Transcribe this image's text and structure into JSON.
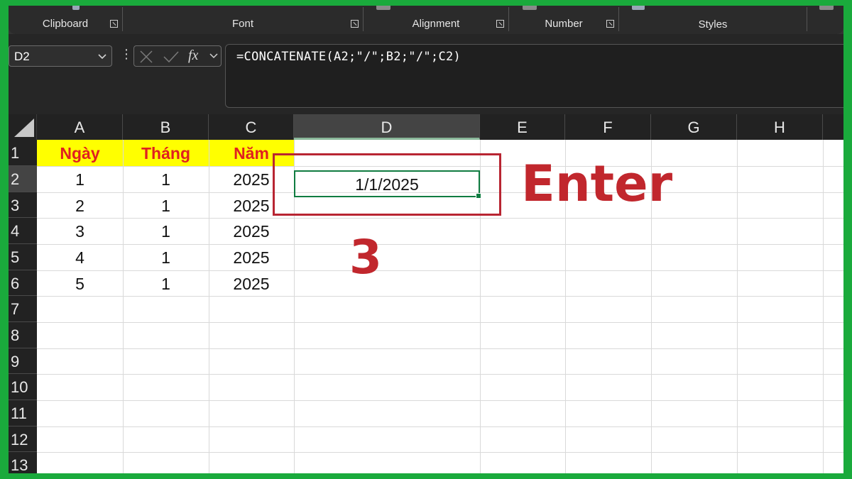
{
  "ribbon": {
    "groups": [
      {
        "label": "Clipboard",
        "launcher": true
      },
      {
        "label": "Font",
        "launcher": true
      },
      {
        "label": "Alignment",
        "launcher": true
      },
      {
        "label": "Number",
        "launcher": true
      },
      {
        "label": "Styles",
        "launcher": false
      }
    ]
  },
  "formula_bar": {
    "name_box": "D2",
    "fx": "fx",
    "formula": "=CONCATENATE(A2;\"/\";B2;\"/\";C2)"
  },
  "sheet": {
    "columns": [
      "A",
      "B",
      "C",
      "D",
      "E",
      "F",
      "G",
      "H"
    ],
    "rows": [
      "1",
      "2",
      "3",
      "4",
      "5",
      "6",
      "7",
      "8",
      "9",
      "10",
      "11",
      "12",
      "13"
    ],
    "selected_column": "D",
    "selected_row": "2",
    "header_cells": [
      "Ngày",
      "Tháng",
      "Năm"
    ],
    "data": [
      [
        "1",
        "1",
        "2025"
      ],
      [
        "2",
        "1",
        "2025"
      ],
      [
        "3",
        "1",
        "2025"
      ],
      [
        "4",
        "1",
        "2025"
      ],
      [
        "5",
        "1",
        "2025"
      ]
    ],
    "result_cell": "1/1/2025"
  },
  "annotations": {
    "enter_label": "Enter",
    "step_number": "3"
  },
  "colors": {
    "frame": "#1aaa3c",
    "header_fill": "#ffff00",
    "header_text": "#e02020",
    "annotation": "#c1272d",
    "selection": "#107c41"
  }
}
